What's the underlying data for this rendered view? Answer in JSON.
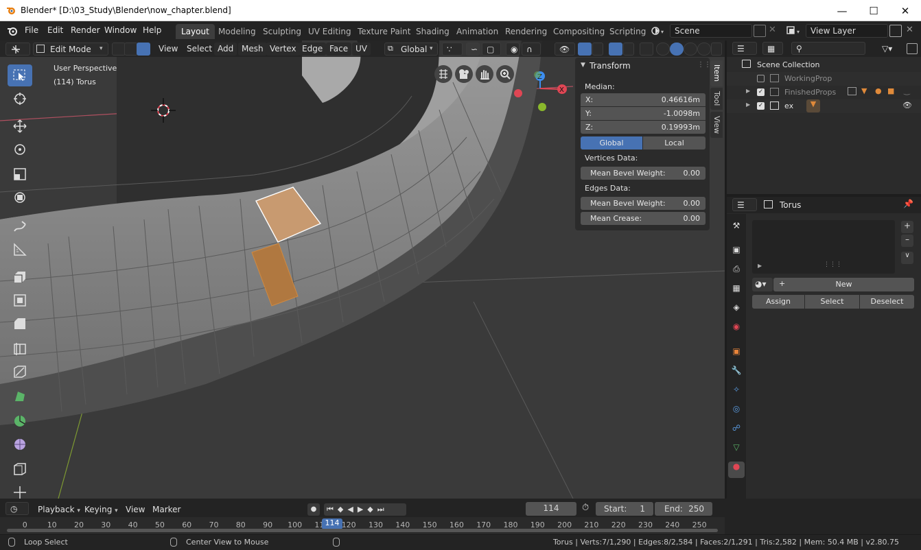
{
  "window": {
    "title": "Blender* [D:\\03_Study\\Blender\\now_chapter.blend]"
  },
  "menubar": {
    "items": [
      "File",
      "Edit",
      "Render",
      "Window",
      "Help"
    ],
    "workspaces": [
      "Layout",
      "Modeling",
      "Sculpting",
      "UV Editing",
      "Texture Paint",
      "Shading",
      "Animation",
      "Rendering",
      "Compositing",
      "Scripting"
    ],
    "active_workspace": "Layout",
    "scene": "Scene",
    "view_layer": "View Layer"
  },
  "viewport_header": {
    "mode": "Edit Mode",
    "menus": [
      "View",
      "Select",
      "Add",
      "Mesh",
      "Vertex",
      "Edge",
      "Face",
      "UV"
    ],
    "orientation": "Global"
  },
  "viewport": {
    "perspective_label": "User Perspective",
    "object_label": "(114) Torus",
    "axis_x": "X",
    "axis_z": "Z"
  },
  "sidebar_tabs": [
    "Item",
    "Tool",
    "View"
  ],
  "transform_panel": {
    "title": "Transform",
    "median_label": "Median:",
    "x_label": "X:",
    "x_value": "0.46616m",
    "y_label": "Y:",
    "y_value": "-1.0098m",
    "z_label": "Z:",
    "z_value": "0.19993m",
    "global_label": "Global",
    "local_label": "Local",
    "vertices_data_label": "Vertices Data:",
    "vert_bevel_label": "Mean Bevel Weight:",
    "vert_bevel_value": "0.00",
    "edges_data_label": "Edges Data:",
    "edge_bevel_label": "Mean Bevel Weight:",
    "edge_bevel_value": "0.00",
    "crease_label": "Mean Crease:",
    "crease_value": "0.00"
  },
  "outliner": {
    "root": "Scene Collection",
    "items": [
      {
        "name": "WorkingProp",
        "checked": false
      },
      {
        "name": "FinishedProps",
        "checked": true
      },
      {
        "name": "ex",
        "checked": true
      }
    ]
  },
  "properties": {
    "object_name": "Torus",
    "new_label": "New",
    "assign_label": "Assign",
    "select_label": "Select",
    "deselect_label": "Deselect"
  },
  "timeline": {
    "menus": [
      "Playback",
      "Keying",
      "View",
      "Marker"
    ],
    "current_frame": "114",
    "start_label": "Start:",
    "start_value": "1",
    "end_label": "End:",
    "end_value": "250",
    "ticks": [
      "0",
      "10",
      "20",
      "30",
      "40",
      "50",
      "60",
      "70",
      "80",
      "90",
      "100",
      "110",
      "120",
      "130",
      "140",
      "150",
      "160",
      "170",
      "180",
      "190",
      "200",
      "210",
      "220",
      "230",
      "240",
      "250"
    ],
    "playhead": "114"
  },
  "statusbar": {
    "left_hint": "Loop Select",
    "mid_hint": "Center View to Mouse",
    "stats": "Torus | Verts:7/1,290 | Edges:8/2,584 | Faces:2/1,291 | Tris:2,582 | Mem: 50.4 MB | v2.80.75"
  },
  "colors": {
    "accent": "#4772b3",
    "selected_face": "#c89a70",
    "active_face": "#b07840",
    "x_axis": "#e04654",
    "y_axis": "#8ab82c",
    "z_axis": "#3d8ef0"
  }
}
